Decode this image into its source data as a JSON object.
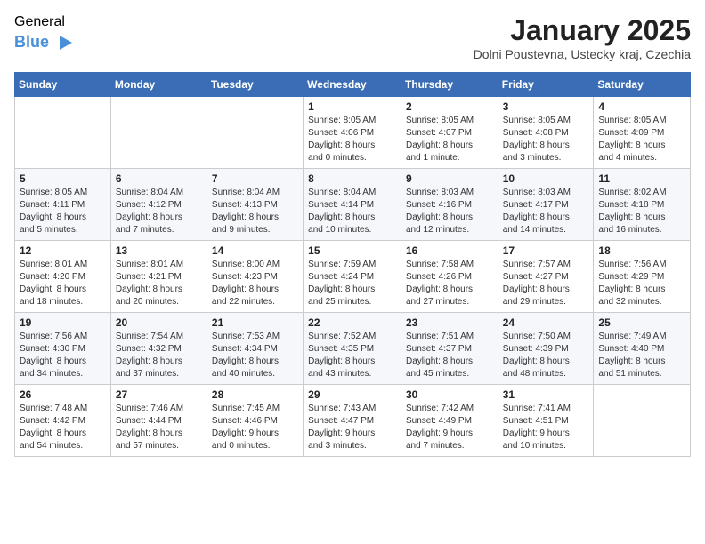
{
  "logo": {
    "general": "General",
    "blue": "Blue"
  },
  "title": "January 2025",
  "subtitle": "Dolni Poustevna, Ustecky kraj, Czechia",
  "days_header": [
    "Sunday",
    "Monday",
    "Tuesday",
    "Wednesday",
    "Thursday",
    "Friday",
    "Saturday"
  ],
  "weeks": [
    [
      {
        "day": "",
        "info": ""
      },
      {
        "day": "",
        "info": ""
      },
      {
        "day": "",
        "info": ""
      },
      {
        "day": "1",
        "info": "Sunrise: 8:05 AM\nSunset: 4:06 PM\nDaylight: 8 hours\nand 0 minutes."
      },
      {
        "day": "2",
        "info": "Sunrise: 8:05 AM\nSunset: 4:07 PM\nDaylight: 8 hours\nand 1 minute."
      },
      {
        "day": "3",
        "info": "Sunrise: 8:05 AM\nSunset: 4:08 PM\nDaylight: 8 hours\nand 3 minutes."
      },
      {
        "day": "4",
        "info": "Sunrise: 8:05 AM\nSunset: 4:09 PM\nDaylight: 8 hours\nand 4 minutes."
      }
    ],
    [
      {
        "day": "5",
        "info": "Sunrise: 8:05 AM\nSunset: 4:11 PM\nDaylight: 8 hours\nand 5 minutes."
      },
      {
        "day": "6",
        "info": "Sunrise: 8:04 AM\nSunset: 4:12 PM\nDaylight: 8 hours\nand 7 minutes."
      },
      {
        "day": "7",
        "info": "Sunrise: 8:04 AM\nSunset: 4:13 PM\nDaylight: 8 hours\nand 9 minutes."
      },
      {
        "day": "8",
        "info": "Sunrise: 8:04 AM\nSunset: 4:14 PM\nDaylight: 8 hours\nand 10 minutes."
      },
      {
        "day": "9",
        "info": "Sunrise: 8:03 AM\nSunset: 4:16 PM\nDaylight: 8 hours\nand 12 minutes."
      },
      {
        "day": "10",
        "info": "Sunrise: 8:03 AM\nSunset: 4:17 PM\nDaylight: 8 hours\nand 14 minutes."
      },
      {
        "day": "11",
        "info": "Sunrise: 8:02 AM\nSunset: 4:18 PM\nDaylight: 8 hours\nand 16 minutes."
      }
    ],
    [
      {
        "day": "12",
        "info": "Sunrise: 8:01 AM\nSunset: 4:20 PM\nDaylight: 8 hours\nand 18 minutes."
      },
      {
        "day": "13",
        "info": "Sunrise: 8:01 AM\nSunset: 4:21 PM\nDaylight: 8 hours\nand 20 minutes."
      },
      {
        "day": "14",
        "info": "Sunrise: 8:00 AM\nSunset: 4:23 PM\nDaylight: 8 hours\nand 22 minutes."
      },
      {
        "day": "15",
        "info": "Sunrise: 7:59 AM\nSunset: 4:24 PM\nDaylight: 8 hours\nand 25 minutes."
      },
      {
        "day": "16",
        "info": "Sunrise: 7:58 AM\nSunset: 4:26 PM\nDaylight: 8 hours\nand 27 minutes."
      },
      {
        "day": "17",
        "info": "Sunrise: 7:57 AM\nSunset: 4:27 PM\nDaylight: 8 hours\nand 29 minutes."
      },
      {
        "day": "18",
        "info": "Sunrise: 7:56 AM\nSunset: 4:29 PM\nDaylight: 8 hours\nand 32 minutes."
      }
    ],
    [
      {
        "day": "19",
        "info": "Sunrise: 7:56 AM\nSunset: 4:30 PM\nDaylight: 8 hours\nand 34 minutes."
      },
      {
        "day": "20",
        "info": "Sunrise: 7:54 AM\nSunset: 4:32 PM\nDaylight: 8 hours\nand 37 minutes."
      },
      {
        "day": "21",
        "info": "Sunrise: 7:53 AM\nSunset: 4:34 PM\nDaylight: 8 hours\nand 40 minutes."
      },
      {
        "day": "22",
        "info": "Sunrise: 7:52 AM\nSunset: 4:35 PM\nDaylight: 8 hours\nand 43 minutes."
      },
      {
        "day": "23",
        "info": "Sunrise: 7:51 AM\nSunset: 4:37 PM\nDaylight: 8 hours\nand 45 minutes."
      },
      {
        "day": "24",
        "info": "Sunrise: 7:50 AM\nSunset: 4:39 PM\nDaylight: 8 hours\nand 48 minutes."
      },
      {
        "day": "25",
        "info": "Sunrise: 7:49 AM\nSunset: 4:40 PM\nDaylight: 8 hours\nand 51 minutes."
      }
    ],
    [
      {
        "day": "26",
        "info": "Sunrise: 7:48 AM\nSunset: 4:42 PM\nDaylight: 8 hours\nand 54 minutes."
      },
      {
        "day": "27",
        "info": "Sunrise: 7:46 AM\nSunset: 4:44 PM\nDaylight: 8 hours\nand 57 minutes."
      },
      {
        "day": "28",
        "info": "Sunrise: 7:45 AM\nSunset: 4:46 PM\nDaylight: 9 hours\nand 0 minutes."
      },
      {
        "day": "29",
        "info": "Sunrise: 7:43 AM\nSunset: 4:47 PM\nDaylight: 9 hours\nand 3 minutes."
      },
      {
        "day": "30",
        "info": "Sunrise: 7:42 AM\nSunset: 4:49 PM\nDaylight: 9 hours\nand 7 minutes."
      },
      {
        "day": "31",
        "info": "Sunrise: 7:41 AM\nSunset: 4:51 PM\nDaylight: 9 hours\nand 10 minutes."
      },
      {
        "day": "",
        "info": ""
      }
    ]
  ]
}
